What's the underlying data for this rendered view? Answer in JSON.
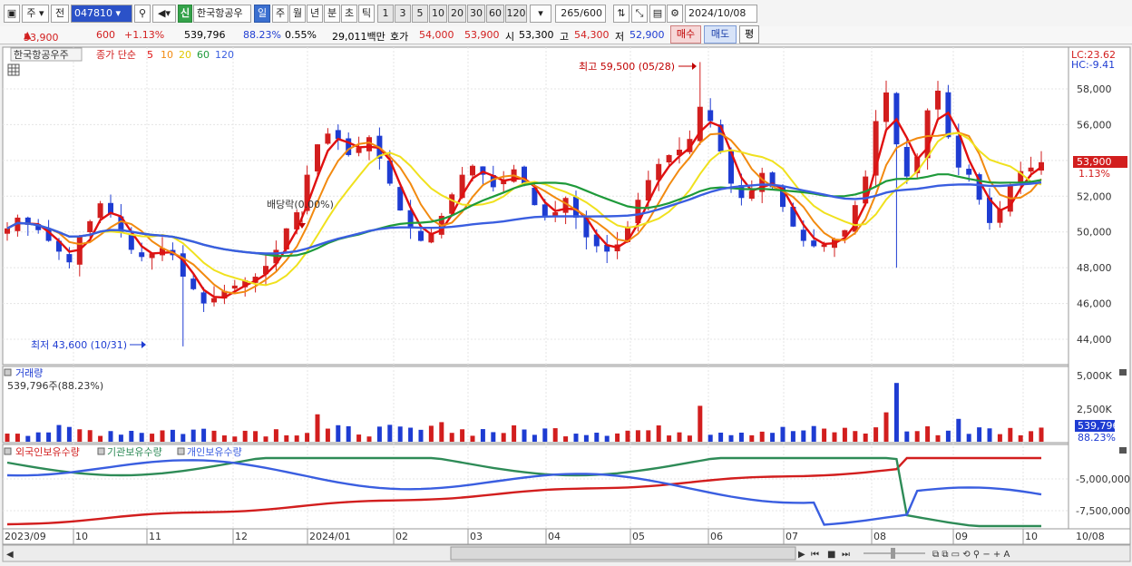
{
  "toolbar": {
    "type_label": "주",
    "mode_label": "전",
    "code": "047810",
    "name": "한국항공우",
    "badge": "신",
    "periods": [
      "일",
      "주",
      "월",
      "년",
      "분",
      "초",
      "틱"
    ],
    "active_period": "일",
    "intervals": [
      "1",
      "3",
      "5",
      "10",
      "20",
      "30",
      "60",
      "120"
    ],
    "count": "265",
    "count_total": "/600",
    "date": "2024/10/08"
  },
  "infobar": {
    "price": "53,900",
    "change": "600",
    "change_pct": "+1.13%",
    "volume": "539,796",
    "vol_ratio": "88.23%",
    "turnover": "0.55%",
    "amount": "29,011백만",
    "ask_label": "호가",
    "ask": "54,000",
    "bid": "53,900",
    "open_label": "시",
    "open": "53,300",
    "high_label": "고",
    "high": "54,300",
    "low_label": "저",
    "low": "52,900",
    "buy_label": "매수",
    "sell_label": "매도",
    "avg_label": "평"
  },
  "price_panel": {
    "legend_name": "한국항공우주",
    "legend_type": "종가 단순",
    "ma_labels": [
      "5",
      "10",
      "20",
      "60",
      "120"
    ],
    "lc_label": "LC:23.62",
    "hc_label": "HC:-9.41",
    "high_annotation": "최고 59,500 (05/28)",
    "low_annotation": "최저 43,600 (10/31)",
    "dividend_annotation": "배당락(0.00%)",
    "y_ticks": [
      "58,000",
      "56,000",
      "54,000",
      "52,000",
      "50,000",
      "48,000",
      "46,000",
      "44,000"
    ],
    "current_price_label": "53,900",
    "current_pct_label": "1.13%"
  },
  "volume_panel": {
    "title": "거래량",
    "summary": "539,796주(88.23%)",
    "y_ticks": [
      "5,000K",
      "2,500K"
    ],
    "current_label": "539,796",
    "current_pct": "88.23%"
  },
  "holding_panel": {
    "legend": [
      "외국인보유수량",
      "기관보유수량",
      "개인보유수량"
    ],
    "y_ticks": [
      "-5,000,000",
      "-7,500,000"
    ]
  },
  "x_axis": {
    "labels": [
      "2023/09",
      "10",
      "11",
      "12",
      "2024/01",
      "02",
      "03",
      "04",
      "05",
      "06",
      "07",
      "08",
      "09",
      "10",
      "10/08"
    ]
  },
  "colors": {
    "up": "#d21e1e",
    "down": "#1e3cd2",
    "ma5": "#e01010",
    "ma10": "#f28a10",
    "ma20": "#f0e11e",
    "ma60": "#1e9a3a",
    "ma120": "#3a5ee0",
    "foreign": "#d21e1e",
    "institution": "#2e8b57",
    "individual": "#3a5ee0"
  },
  "chart_data": {
    "type": "line",
    "title": "",
    "price_range": [
      42800,
      59800
    ],
    "high": {
      "date": "05/28",
      "value": 59500
    },
    "low": {
      "date": "10/31",
      "value": 43600
    },
    "close_approx": [
      50200,
      50800,
      50400,
      50100,
      49500,
      48900,
      48300,
      49800,
      50600,
      51600,
      51000,
      50000,
      49000,
      48600,
      48800,
      49100,
      48700,
      47500,
      46800,
      46000,
      46300,
      46700,
      47000,
      47300,
      47500,
      48100,
      49000,
      50200,
      51100,
      53200,
      54900,
      55500,
      55200,
      54300,
      54700,
      55300,
      54100,
      52700,
      51200,
      50200,
      49500,
      49900,
      50900,
      52100,
      53200,
      53700,
      53200,
      52500,
      52900,
      53500,
      52600,
      51500,
      50900,
      51100,
      51900,
      50800,
      49700,
      49200,
      48900,
      49300,
      50300,
      51800,
      52900,
      53800,
      54300,
      54600,
      55200,
      57000,
      56200,
      54500,
      52700,
      51900,
      52300,
      53300,
      52500,
      51400,
      50300,
      49500,
      49200,
      49300,
      49600,
      50100,
      51500,
      53100,
      56200,
      57800,
      54900,
      53100,
      54200,
      56800,
      57900,
      55300,
      53600,
      53200,
      51800,
      50500,
      51300,
      52600,
      53400,
      53600,
      53900
    ],
    "series": [
      {
        "name": "외국인보유수량"
      },
      {
        "name": "기관보유수량"
      },
      {
        "name": "개인보유수량"
      }
    ]
  }
}
